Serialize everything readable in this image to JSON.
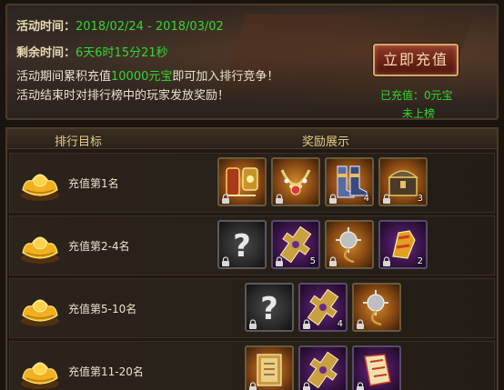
{
  "event": {
    "time_label": "活动时间：",
    "time_value": "2018/02/24 - 2018/03/02",
    "remaining_label": "剩余时间：",
    "remaining_value": "6天6时15分21秒",
    "desc1_prefix": "活动期间累积充值",
    "desc1_amount": "10000元宝",
    "desc1_suffix": "即可加入排行竞争！",
    "desc2": "活动结束时对排行榜中的玩家发放奖励！",
    "recharge_button": "立即充值",
    "recharged_text": "已充值：0元宝",
    "rank_status": "未上榜"
  },
  "table": {
    "header_target": "排行目标",
    "header_reward": "奖励展示",
    "rows": [
      {
        "label": "充值第1名",
        "rewards": [
          {
            "icon": "armor-set-icon",
            "rarity": "orange",
            "count": ""
          },
          {
            "icon": "necklace-icon",
            "rarity": "orange",
            "count": ""
          },
          {
            "icon": "boots-icon",
            "rarity": "orange",
            "count": "4"
          },
          {
            "icon": "treasure-chest-icon",
            "rarity": "orange",
            "count": "3"
          }
        ]
      },
      {
        "label": "充值第2-4名",
        "rewards": [
          {
            "icon": "mystery-item-icon",
            "rarity": "gray",
            "count": ""
          },
          {
            "icon": "scroll-token-icon",
            "rarity": "purple",
            "count": "5"
          },
          {
            "icon": "spiked-flail-icon",
            "rarity": "orange",
            "count": ""
          },
          {
            "icon": "golden-gauntlet-icon",
            "rarity": "purple",
            "count": "2"
          }
        ]
      },
      {
        "label": "充值第5-10名",
        "rewards": [
          {
            "icon": "mystery-item-icon",
            "rarity": "gray",
            "count": ""
          },
          {
            "icon": "scroll-token-icon",
            "rarity": "purple",
            "count": "4"
          },
          {
            "icon": "spiked-flail-icon",
            "rarity": "orange",
            "count": ""
          }
        ]
      },
      {
        "label": "充值第11-20名",
        "rewards": [
          {
            "icon": "book-icon",
            "rarity": "orange",
            "count": ""
          },
          {
            "icon": "scroll-token-icon",
            "rarity": "purple",
            "count": ""
          },
          {
            "icon": "paper-scroll-icon",
            "rarity": "purple",
            "count": ""
          }
        ]
      }
    ]
  },
  "colors": {
    "highlight_green": "#33d633",
    "header_gold": "#e2cc8a",
    "button_red": "#6b2217"
  }
}
